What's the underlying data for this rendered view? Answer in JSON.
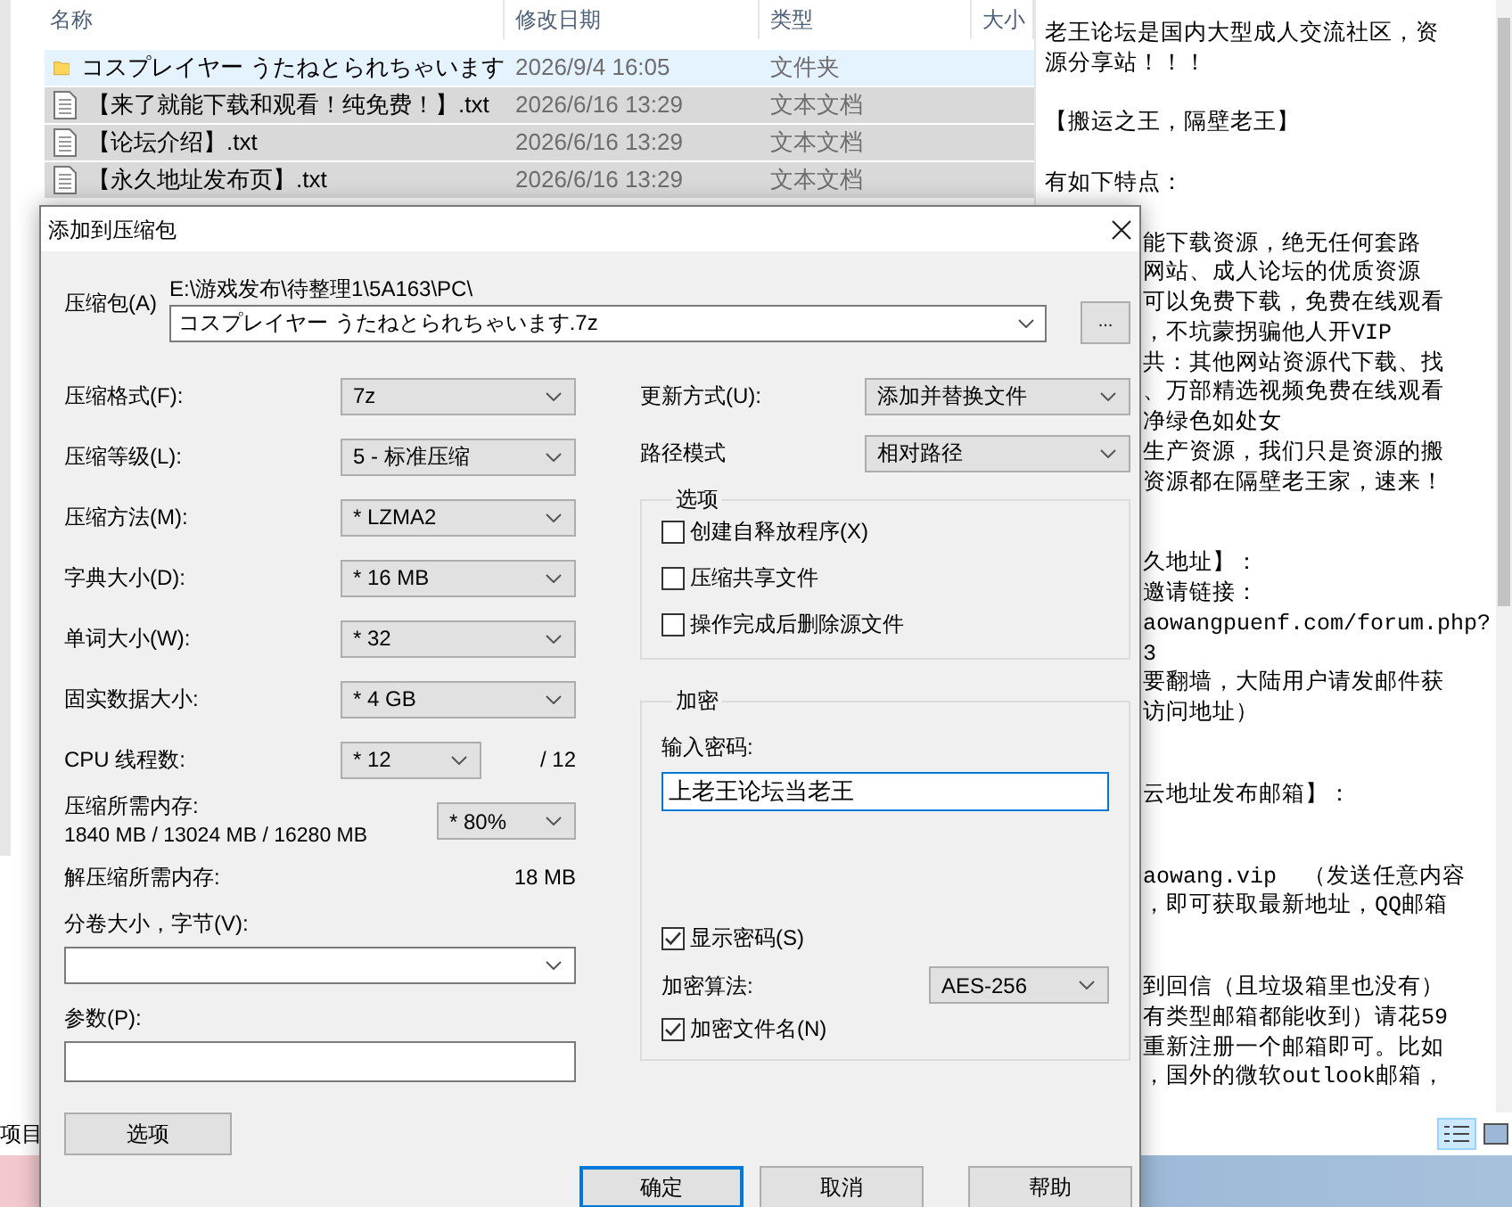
{
  "explorer": {
    "columns": [
      "名称",
      "修改日期",
      "类型",
      "大小"
    ],
    "rows": [
      {
        "kind": "folder",
        "name": "コスプレイヤー うたねとられちゃいます",
        "date": "2026/9/4 16:05",
        "type": "文件夹",
        "selected": false,
        "hovered": true
      },
      {
        "kind": "text",
        "name": "【来了就能下载和观看！纯免费！】.txt",
        "date": "2026/6/16 13:29",
        "type": "文本文档",
        "selected": true,
        "hovered": false
      },
      {
        "kind": "text",
        "name": "【论坛介绍】.txt",
        "date": "2026/6/16 13:29",
        "type": "文本文档",
        "selected": true,
        "hovered": false
      },
      {
        "kind": "text",
        "name": "【永久地址发布页】.txt",
        "date": "2026/6/16 13:29",
        "type": "文本文档",
        "selected": true,
        "hovered": false
      }
    ],
    "status_text": "项目",
    "preview": {
      "top_paragraphs": [
        [
          "老王论坛是国内大型成人交流社区，资",
          "源分享站！！！"
        ],
        [
          "【搬运之王，隔壁老王】"
        ],
        [
          "有如下特点："
        ]
      ],
      "lower_paragraphs": [
        [
          "能下载资源，绝无任何套路",
          "网站、成人论坛的优质资源",
          "可以免费下载，免费在线观看",
          "，不坑蒙拐骗他人开VIP",
          "共：其他网站资源代下载、找",
          "、万部精选视频免费在线观看",
          "净绿色如处女",
          "生产资源，我们只是资源的搬",
          "资源都在隔壁老王家，速来！"
        ],
        [
          "久地址】：",
          "邀请链接：",
          "aowangpuenf.com/forum.php?",
          "3",
          "要翻墙，大陆用户请发邮件获",
          "访问地址）"
        ],
        [
          "云地址发布邮箱】："
        ],
        [
          "aowang.vip  （发送任意内容",
          "，即可获取最新地址，QQ邮箱"
        ],
        [
          "到回信（且垃圾箱里也没有）",
          "有类型邮箱都能收到）请花59",
          "重新注册一个邮箱即可。比如",
          "，国外的微软outlook邮箱，"
        ]
      ]
    }
  },
  "dialog": {
    "title": "添加到压缩包",
    "archive": {
      "label": "压缩包(A)",
      "path": "E:\\游戏发布\\待整理1\\5A163\\PC\\",
      "value": "コスプレイヤー うたねとられちゃいます.7z",
      "browse": "..."
    },
    "left_fields": [
      {
        "label": "压缩格式(F):",
        "value": "7z"
      },
      {
        "label": "压缩等级(L):",
        "value": "5 - 标准压缩"
      },
      {
        "label": "压缩方法(M):",
        "value": "* LZMA2"
      },
      {
        "label": "字典大小(D):",
        "value": "* 16 MB"
      },
      {
        "label": "单词大小(W):",
        "value": "* 32"
      },
      {
        "label": "固实数据大小:",
        "value": "* 4 GB"
      }
    ],
    "threads": {
      "label": "CPU 线程数:",
      "value": "* 12",
      "max": "/ 12"
    },
    "memory": {
      "label": "压缩所需内存:",
      "detail": "1840 MB / 13024 MB / 16280 MB",
      "value": "* 80%"
    },
    "decompress": {
      "label": "解压缩所需内存:",
      "value": "18 MB"
    },
    "split": {
      "label": "分卷大小，字节(V):"
    },
    "params": {
      "label": "参数(P):"
    },
    "options_button": "选项",
    "update": {
      "label": "更新方式(U):",
      "value": "添加并替换文件"
    },
    "path_mode": {
      "label": "路径模式",
      "value": "相对路径"
    },
    "options": {
      "title": "选项",
      "items": [
        {
          "label": "创建自释放程序(X)",
          "checked": false
        },
        {
          "label": "压缩共享文件",
          "checked": false
        },
        {
          "label": "操作完成后删除源文件",
          "checked": false
        }
      ]
    },
    "encryption": {
      "title": "加密",
      "password_label": "输入密码:",
      "password": "上老王论坛当老王",
      "show_password": {
        "label": "显示密码(S)",
        "checked": true
      },
      "method_label": "加密算法:",
      "method": "AES-256",
      "encrypt_names": {
        "label": "加密文件名(N)",
        "checked": true
      }
    },
    "buttons": [
      {
        "label": "确定",
        "focused": true
      },
      {
        "label": "取消",
        "focused": false
      },
      {
        "label": "帮助",
        "focused": false
      }
    ]
  }
}
